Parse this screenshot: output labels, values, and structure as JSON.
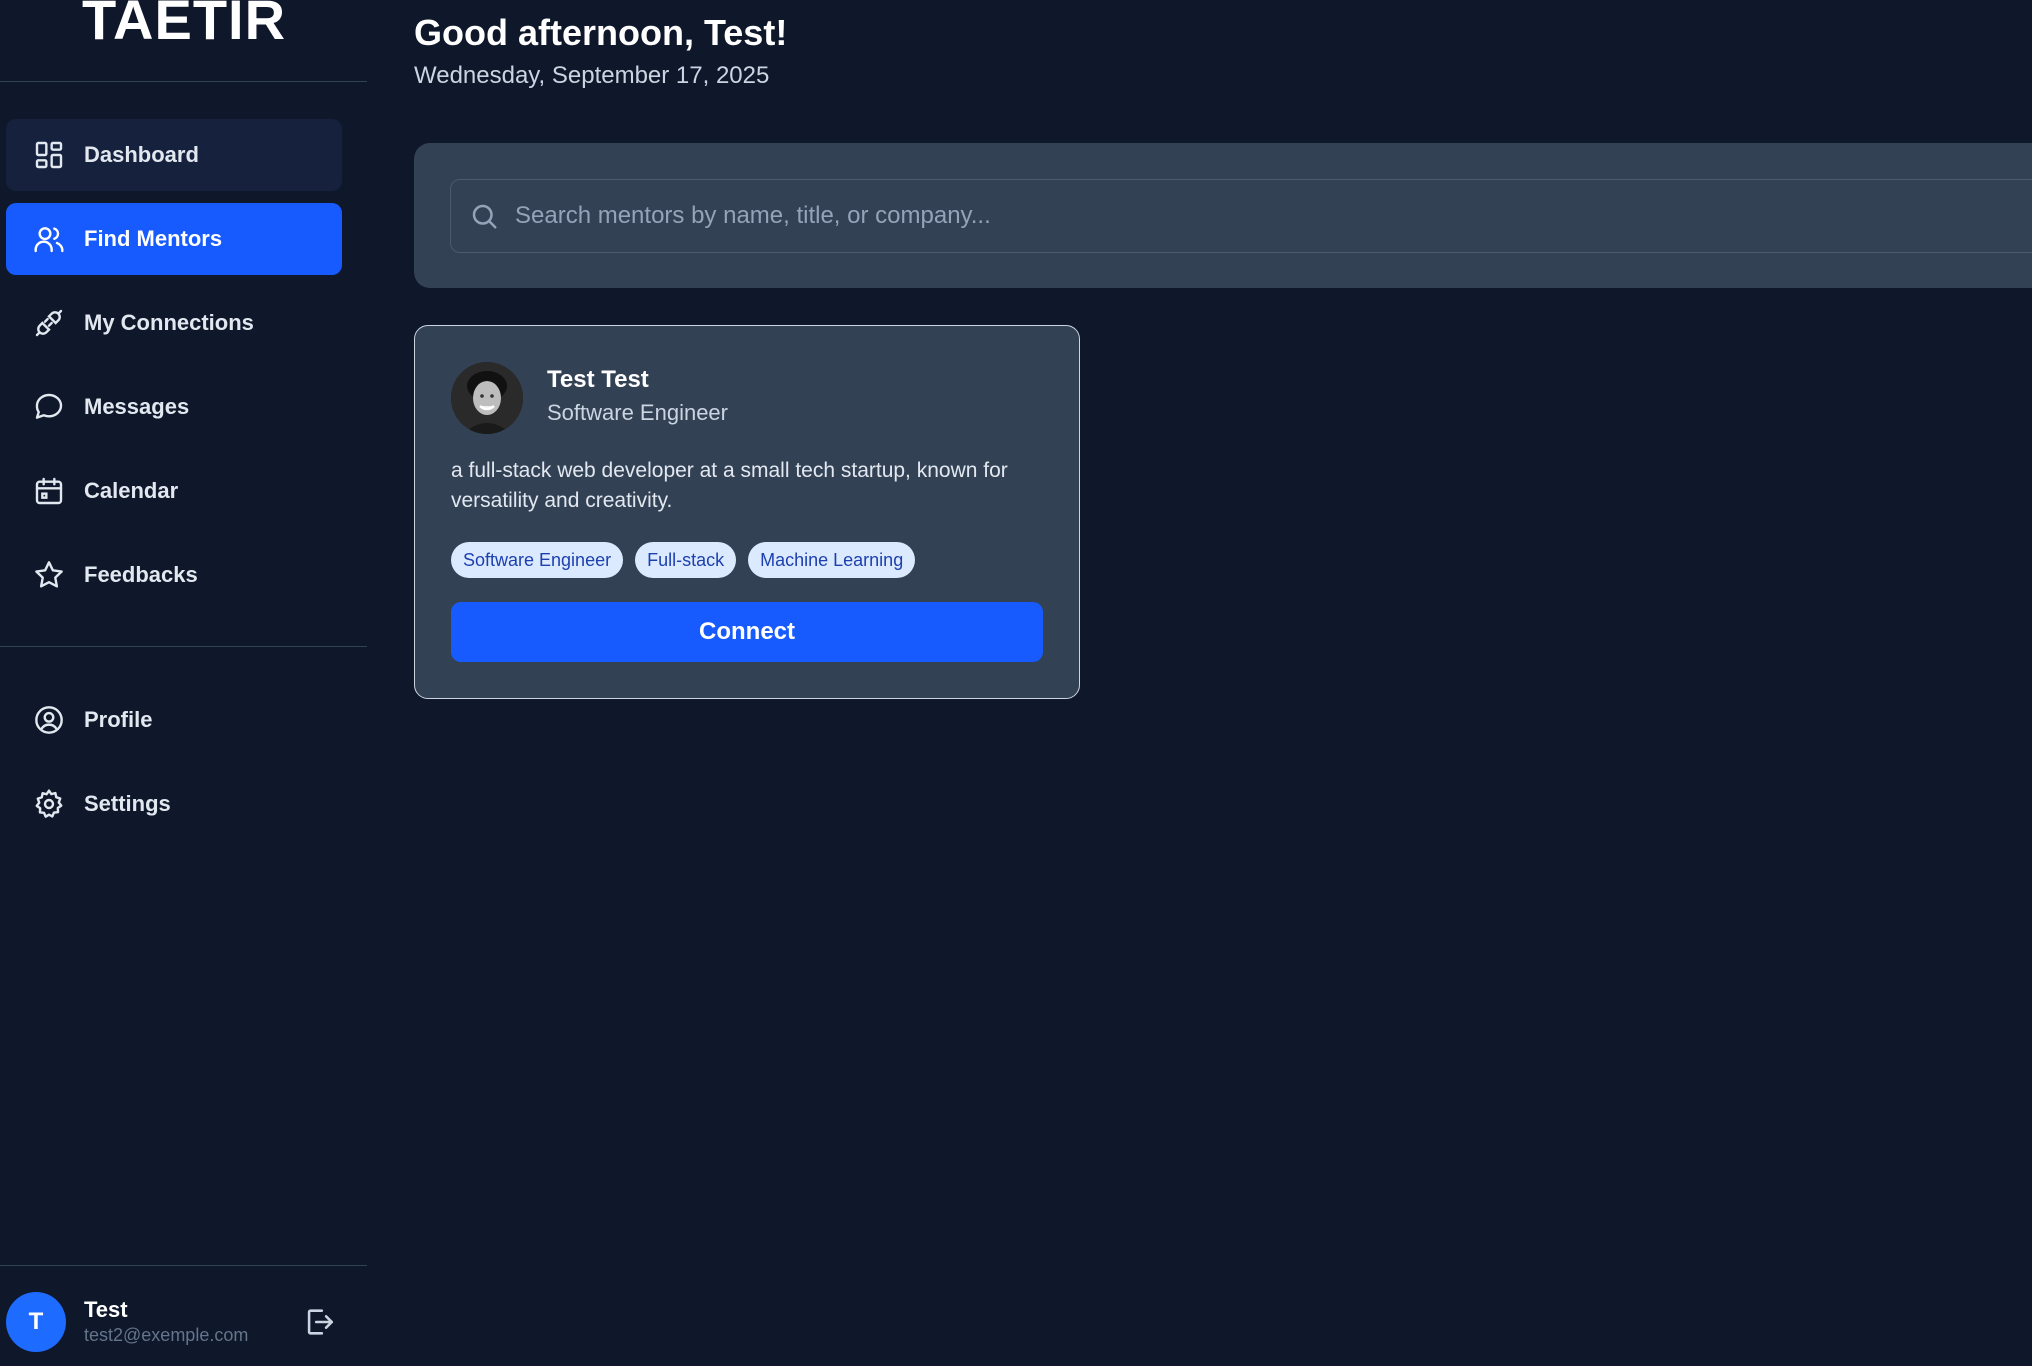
{
  "brand": {
    "logo": "TAETIR"
  },
  "sidebar": {
    "items": [
      {
        "label": "Dashboard",
        "icon": "dashboard-icon"
      },
      {
        "label": "Find Mentors",
        "icon": "users-icon"
      },
      {
        "label": "My Connections",
        "icon": "plug-icon"
      },
      {
        "label": "Messages",
        "icon": "message-icon"
      },
      {
        "label": "Calendar",
        "icon": "calendar-icon"
      },
      {
        "label": "Feedbacks",
        "icon": "star-icon"
      }
    ],
    "bottom_items": [
      {
        "label": "Profile",
        "icon": "user-circle-icon"
      },
      {
        "label": "Settings",
        "icon": "gear-icon"
      }
    ],
    "active_item": "Find Mentors"
  },
  "user": {
    "initial": "T",
    "name": "Test",
    "email": "test2@exemple.com"
  },
  "header": {
    "greeting": "Good afternoon, Test!",
    "date": "Wednesday, September 17, 2025"
  },
  "search": {
    "placeholder": "Search mentors by name, title, or company...",
    "value": ""
  },
  "mentors": [
    {
      "name": "Test Test",
      "title": "Software Engineer",
      "bio": "a full-stack web developer at a small tech startup, known for versatility and creativity.",
      "tags": [
        "Software Engineer",
        "Full-stack",
        "Machine Learning"
      ],
      "action": "Connect"
    }
  ],
  "colors": {
    "background": "#0f172a",
    "panel": "#334155",
    "accent": "#175bff",
    "tag_bg": "#dbeafe",
    "tag_text": "#1e40af"
  }
}
